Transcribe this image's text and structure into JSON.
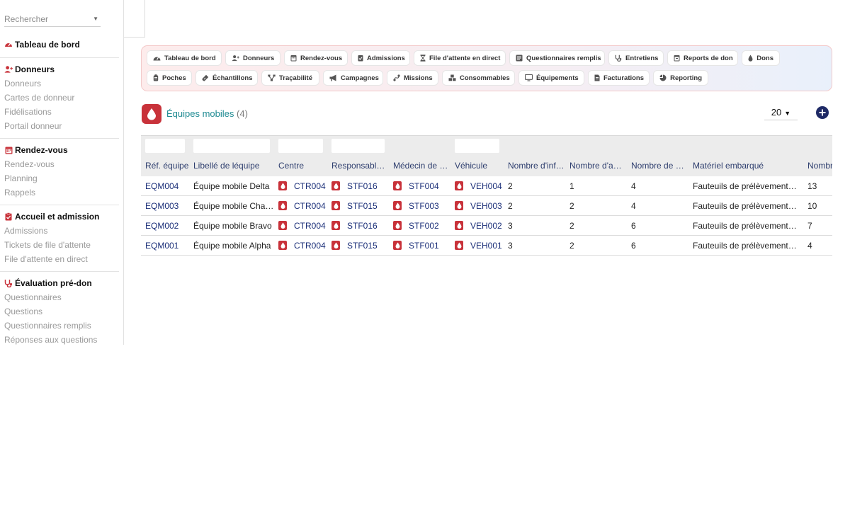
{
  "search": {
    "placeholder": "Rechercher"
  },
  "sidebar": {
    "dashboard": "Tableau de bord",
    "sections": [
      {
        "title": "Donneurs",
        "icon": "add-user-icon",
        "items": [
          "Donneurs",
          "Cartes de donneur",
          "Fidélisations",
          "Portail donneur"
        ]
      },
      {
        "title": "Rendez-vous",
        "icon": "calendar-icon",
        "items": [
          "Rendez-vous",
          "Planning",
          "Rappels"
        ]
      },
      {
        "title": "Accueil et admission",
        "icon": "clipboard-icon",
        "items": [
          "Admissions",
          "Tickets de file d'attente",
          "File d'attente en direct"
        ]
      },
      {
        "title": "Évaluation pré-don",
        "icon": "stethoscope-icon",
        "items": [
          "Questionnaires",
          "Questions",
          "Questionnaires remplis",
          "Réponses aux questions"
        ]
      }
    ]
  },
  "nav": {
    "row1": [
      "Tableau de bord",
      "Donneurs",
      "Rendez-vous",
      "Admissions",
      "File d'attente en direct",
      "Questionnaires remplis",
      "Entretiens",
      "Reports de don",
      "Dons"
    ],
    "row2": [
      "Poches",
      "Échantillons",
      "Traçabilité",
      "Campagnes",
      "Missions",
      "Consommables",
      "Équipements",
      "Facturations",
      "Reporting"
    ]
  },
  "page": {
    "title": "Équipes mobiles",
    "count": "(4)",
    "page_size": "20"
  },
  "table": {
    "columns": [
      "Réf. équipe",
      "Libellé de léquipe",
      "Centre",
      "Responsabl…",
      "Médecin de l…",
      "Véhicule",
      "Nombre d'inf…",
      "Nombre d'ag…",
      "Nombre de p…",
      "Matériel embarqué",
      "Nombre"
    ],
    "rows": [
      {
        "ref": "EQM004",
        "label": "Équipe mobile Delta",
        "center": "CTR004",
        "resp": "STF016",
        "doctor": "STF004",
        "vehicle": "VEH004",
        "n1": "2",
        "n2": "1",
        "n3": "4",
        "material": "Fauteuils de prélèvement, b…",
        "n4": "13"
      },
      {
        "ref": "EQM003",
        "label": "Équipe mobile Charlie",
        "center": "CTR004",
        "resp": "STF015",
        "doctor": "STF003",
        "vehicle": "VEH003",
        "n1": "2",
        "n2": "2",
        "n3": "4",
        "material": "Fauteuils de prélèvement, b…",
        "n4": "10"
      },
      {
        "ref": "EQM002",
        "label": "Équipe mobile Bravo",
        "center": "CTR004",
        "resp": "STF016",
        "doctor": "STF002",
        "vehicle": "VEH002",
        "n1": "3",
        "n2": "2",
        "n3": "6",
        "material": "Fauteuils de prélèvement, b…",
        "n4": "7"
      },
      {
        "ref": "EQM001",
        "label": "Équipe mobile Alpha",
        "center": "CTR004",
        "resp": "STF015",
        "doctor": "STF001",
        "vehicle": "VEH001",
        "n1": "3",
        "n2": "2",
        "n3": "6",
        "material": "Fauteuils de prélèvement, b…",
        "n4": "4"
      }
    ]
  },
  "colors": {
    "accent_red": "#c8323a",
    "title_teal": "#1e8a92",
    "link_navy": "#1a2e78",
    "add_button": "#1f2a66"
  }
}
